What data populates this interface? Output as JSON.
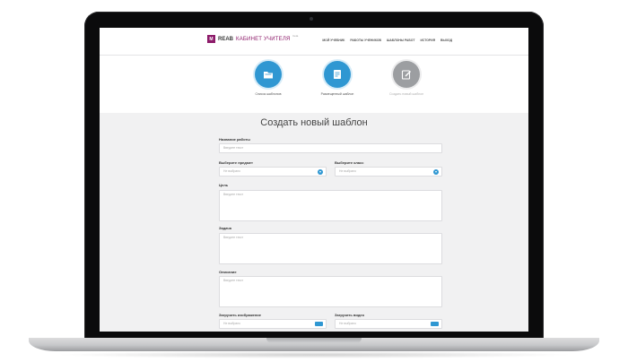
{
  "header": {
    "logo_mark": "M",
    "logo_brand": "REAB",
    "logo_sub": "КАБИНЕТ УЧИТЕЛЯ",
    "logo_beta": "beta",
    "nav": [
      "МОЙ УЧЕБНИК",
      "РАБОТЫ УЧЕНИКОВ",
      "ШАБЛОНЫ РАБОТ",
      "ИСТОРИЯ",
      "ВЫХОД"
    ]
  },
  "steps": [
    {
      "label": "Список шаблонов",
      "icon": "folder-icon",
      "state": "active"
    },
    {
      "label": "Размещенный шаблон",
      "icon": "document-icon",
      "state": "active"
    },
    {
      "label": "Создать новый шаблон",
      "icon": "edit-icon",
      "state": "inactive"
    }
  ],
  "form": {
    "title": "Создать новый шаблон",
    "work_name": {
      "label": "Название работы",
      "placeholder": "Введите текст"
    },
    "subject": {
      "label": "Выберите предмет",
      "value": "Не выбрано"
    },
    "grade": {
      "label": "Выберите класс",
      "value": "Не выбрано"
    },
    "goal": {
      "label": "Цель",
      "placeholder": "Введите текст"
    },
    "task": {
      "label": "Задача",
      "placeholder": "Введите текст"
    },
    "description": {
      "label": "Описание",
      "placeholder": "Введите текст"
    },
    "upload_image": {
      "label": "Загрузить изображение",
      "value": "Не выбрано"
    },
    "upload_video": {
      "label": "Загрузить видео",
      "value": "Не выбрано"
    }
  },
  "colors": {
    "accent": "#2f97d2",
    "brand": "#8d1b6a",
    "inactive": "#9c9ea1"
  }
}
